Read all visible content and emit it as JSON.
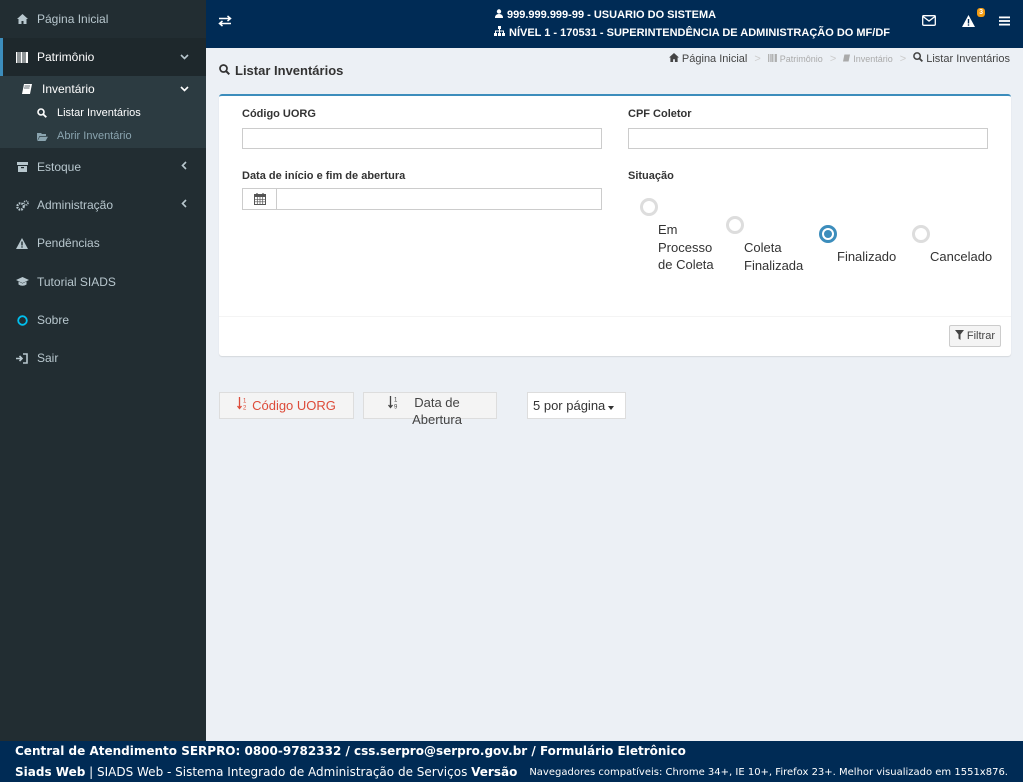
{
  "sidebar": {
    "items": [
      {
        "label": "Página Inicial",
        "icon": "home-icon"
      },
      {
        "label": "Patrimônio",
        "icon": "barcode-icon"
      },
      {
        "label": "Estoque",
        "icon": "archive-icon"
      },
      {
        "label": "Administração",
        "icon": "cogs-icon"
      },
      {
        "label": "Pendências",
        "icon": "warning-icon"
      },
      {
        "label": "Tutorial SIADS",
        "icon": "graduation-cap-icon"
      },
      {
        "label": "Sobre",
        "icon": "circle-icon"
      },
      {
        "label": "Sair",
        "icon": "sign-in-icon"
      }
    ],
    "submenu": {
      "label": "Inventário",
      "icon": "book-icon",
      "items": [
        {
          "label": "Listar Inventários",
          "icon": "search-icon"
        },
        {
          "label": "Abrir Inventário",
          "icon": "folder-open-icon"
        }
      ]
    }
  },
  "header": {
    "user": "999.999.999-99 - USUARIO DO SISTEMA",
    "level": "NÍVEL 1 - 170531 - SUPERINTENDÊNCIA DE ADMINISTRAÇÃO DO MF/DF",
    "alert_count": "3"
  },
  "page": {
    "title": "Listar Inventários",
    "breadcrumb": [
      "Página Inicial",
      "Patrimônio",
      "Inventário",
      "Listar Inventários"
    ]
  },
  "filters": {
    "uorg_label": "Código UORG",
    "uorg_value": "",
    "cpf_label": "CPF Coletor",
    "cpf_value": "",
    "date_label": "Data de início e fim de abertura",
    "date_value": "",
    "situacao_label": "Situação",
    "situacao_options": [
      {
        "label": "Em Processo de Coleta",
        "selected": false
      },
      {
        "label": "Coleta Finalizada",
        "selected": false
      },
      {
        "label": "Finalizado",
        "selected": true
      },
      {
        "label": "Cancelado",
        "selected": false
      }
    ],
    "filter_button": "Filtrar"
  },
  "sort": {
    "uorg": "Código UORG",
    "date": "Data de Abertura",
    "perpage": "5 por página"
  },
  "footer": {
    "line1": "Central de Atendimento SERPRO: 0800-9782332 / css.serpro@serpro.gov.br / Formulário Eletrônico",
    "brand": "Siads Web",
    "desc": " | SIADS Web - Sistema Integrado de Administração de Serviços ",
    "version": "Versão",
    "browsers": "Navegadores compatíveis: Chrome 34+, IE 10+, Firefox 23+. Melhor visualizado em 1551x876."
  },
  "colors": {
    "sidebar_bg": "#222d32",
    "header_bg": "#002b55",
    "accent": "#3c8dbc",
    "danger": "#dd4b39"
  }
}
